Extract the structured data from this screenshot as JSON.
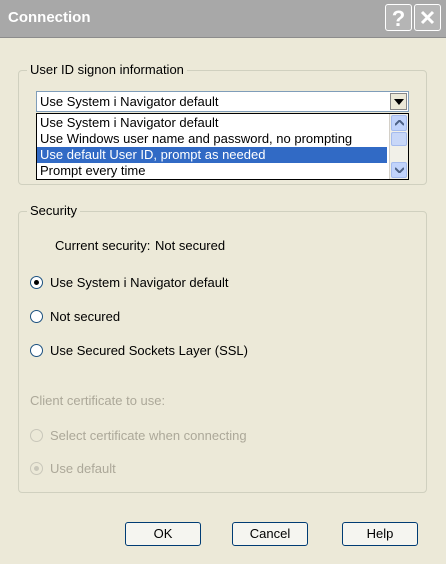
{
  "window": {
    "title": "Connection",
    "help_glyph": "?"
  },
  "signon": {
    "group_label": "User ID signon information",
    "selected_value": "Use System i Navigator default",
    "options": [
      "Use System i Navigator default",
      "Use Windows user name and password, no prompting",
      "Use default User ID, prompt as needed",
      "Prompt every time"
    ],
    "highlighted_index": 2
  },
  "security": {
    "group_label": "Security",
    "current_label": "Current security:",
    "current_value": "Not secured",
    "options": [
      "Use System i Navigator default",
      "Not secured",
      "Use Secured Sockets Layer (SSL)"
    ],
    "checked_index": 0,
    "cert_label": "Client certificate to use:",
    "cert_options": [
      "Select certificate when connecting",
      "Use default"
    ],
    "cert_checked_index": 1
  },
  "buttons": {
    "ok": "OK",
    "cancel": "Cancel",
    "help": "Help"
  },
  "colors": {
    "selection": "#316AC5",
    "face": "#ECE9D8",
    "titlebar": "#A8A8A8"
  }
}
